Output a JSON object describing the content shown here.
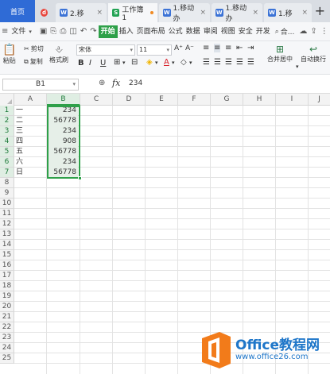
{
  "tabs": {
    "home": "首页",
    "items": [
      {
        "label": "2.移",
        "badge": "W"
      },
      {
        "label": "工作簿1",
        "badge": "S",
        "active": true
      },
      {
        "label": "1.移动办",
        "badge": "W"
      },
      {
        "label": "1.移动办",
        "badge": "W"
      },
      {
        "label": "1.移",
        "badge": "W"
      }
    ],
    "plus": "+"
  },
  "menu": {
    "file": "文件",
    "items": [
      "开始",
      "插入",
      "页面布局",
      "公式",
      "数据",
      "审阅",
      "视图",
      "安全",
      "开发"
    ],
    "active": "开始",
    "search": "合..."
  },
  "ribbon": {
    "paste": "粘贴",
    "cut": "剪切",
    "copy": "复制",
    "format_painter": "格式刷",
    "font_name": "宋体",
    "font_size": "11",
    "bold": "B",
    "italic": "I",
    "underline": "U",
    "font_color": "A",
    "merge_center": "合并居中",
    "wrap_text": "自动换行"
  },
  "formula_bar": {
    "cell_ref": "B1",
    "fx": "fx",
    "value": "234"
  },
  "sheet": {
    "columns": [
      "A",
      "B",
      "C",
      "D",
      "E",
      "F",
      "G",
      "H",
      "I",
      "J"
    ],
    "selected_column": "B",
    "row_count": 25,
    "rows": [
      {
        "a": "一",
        "b": "234"
      },
      {
        "a": "二",
        "b": "56778"
      },
      {
        "a": "三",
        "b": "234"
      },
      {
        "a": "四",
        "b": "908"
      },
      {
        "a": "五",
        "b": "56778"
      },
      {
        "a": "六",
        "b": "234"
      },
      {
        "a": "日",
        "b": "56778"
      }
    ]
  },
  "watermark": {
    "title": "Office教程网",
    "url": "www.office26.com"
  },
  "colors": {
    "accent": "#2ea049",
    "home_tab": "#2f6bd6",
    "watermark": "#1e76c9",
    "logo_orange": "#f27b1a"
  }
}
